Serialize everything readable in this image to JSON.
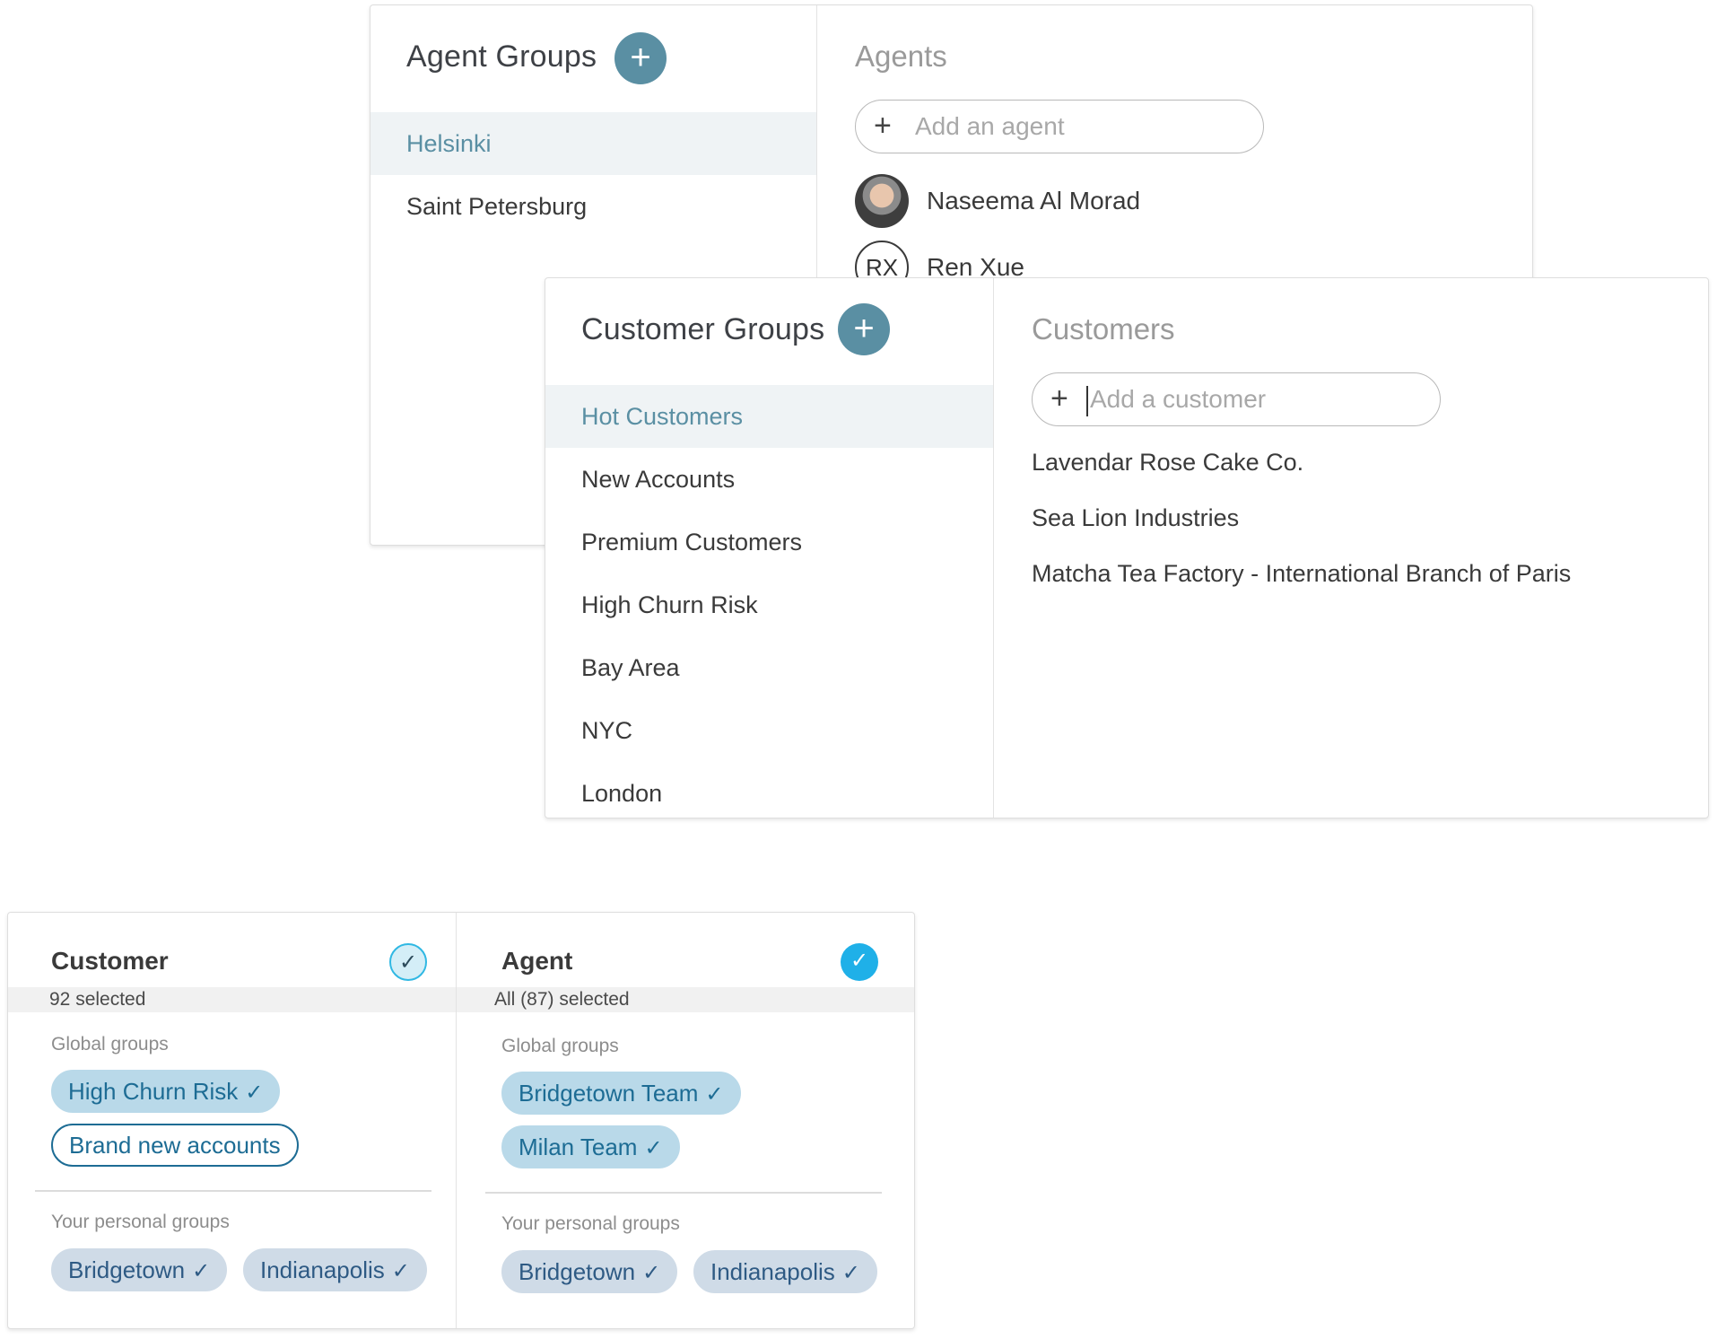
{
  "agent_groups": {
    "title": "Agent Groups",
    "add_label": "+",
    "items": [
      "Helsinki",
      "Saint Petersburg"
    ],
    "agents_title": "Agents",
    "add_agent_placeholder": "Add an agent",
    "agents": [
      {
        "name": "Naseema Al Morad",
        "initials": ""
      },
      {
        "name": "Ren Xue",
        "initials": "RX"
      }
    ]
  },
  "customer_groups": {
    "title": "Customer Groups",
    "add_label": "+",
    "items": [
      "Hot Customers",
      "New Accounts",
      "Premium Customers",
      "High Churn Risk",
      "Bay Area",
      "NYC",
      "London"
    ],
    "customers_title": "Customers",
    "add_customer_placeholder": "Add a customer",
    "customers": [
      "Lavendar Rose Cake Co.",
      "Sea Lion Industries",
      "Matcha Tea Factory - International Branch of Paris"
    ]
  },
  "selection": {
    "customer": {
      "title": "Customer",
      "selected_text": "92 selected",
      "global_label": "Global groups",
      "global_tags": [
        {
          "label": "High Churn Risk",
          "checked": true
        },
        {
          "label": "Brand new accounts",
          "checked": false
        }
      ],
      "personal_label": "Your personal groups",
      "personal_tags": [
        {
          "label": "Bridgetown",
          "checked": true
        },
        {
          "label": "Indianapolis",
          "checked": true
        }
      ]
    },
    "agent": {
      "title": "Agent",
      "selected_text": "All (87) selected",
      "global_label": "Global groups",
      "global_tags": [
        {
          "label": "Bridgetown Team",
          "checked": true
        },
        {
          "label": "Milan Team",
          "checked": true
        }
      ],
      "personal_label": "Your personal groups",
      "personal_tags": [
        {
          "label": "Bridgetown",
          "checked": true
        },
        {
          "label": "Indianapolis",
          "checked": true
        }
      ]
    },
    "check_glyph": "✓"
  },
  "colors": {
    "accent_teal": "#5a8fa3",
    "tag_blue": "#1d6c94",
    "check_blue": "#1fb0e8"
  }
}
